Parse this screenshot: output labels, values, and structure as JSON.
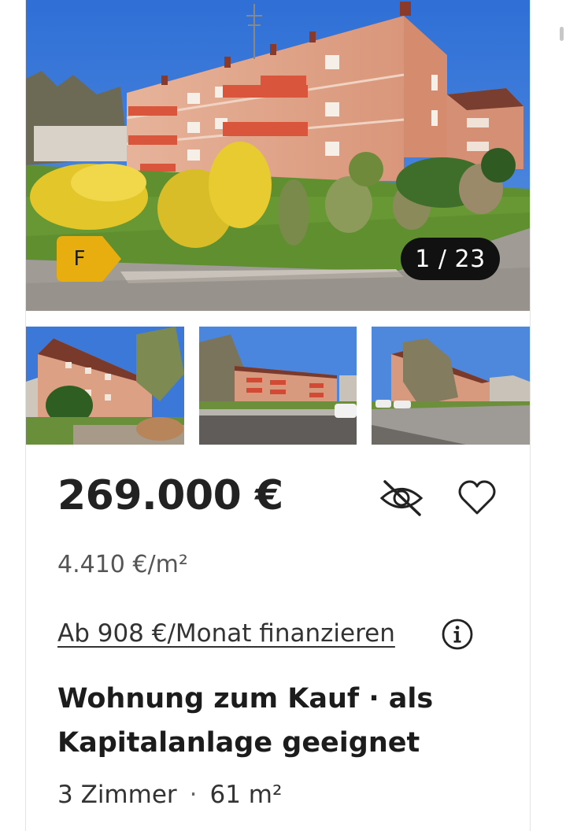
{
  "gallery": {
    "energy_class": "F",
    "counter": "1 / 23",
    "colors": {
      "energy_badge": "#e8ad0f",
      "counter_bg": "#111111"
    },
    "thumbnails": [
      {
        "name": "thumbnail-1"
      },
      {
        "name": "thumbnail-2"
      },
      {
        "name": "thumbnail-3"
      }
    ]
  },
  "listing": {
    "price": "269.000 €",
    "price_per_sqm": "4.410 €/m²",
    "financing_link": "Ab 908 €/Monat finanzieren",
    "title": "Wohnung zum Kauf · als Kapitalanlage geeignet",
    "rooms": "3 Zimmer",
    "fact_separator": "·",
    "area": "61 m²"
  },
  "actions": {
    "hide_icon": "eye-off-icon",
    "favorite_icon": "heart-icon",
    "info_icon": "info-icon"
  }
}
